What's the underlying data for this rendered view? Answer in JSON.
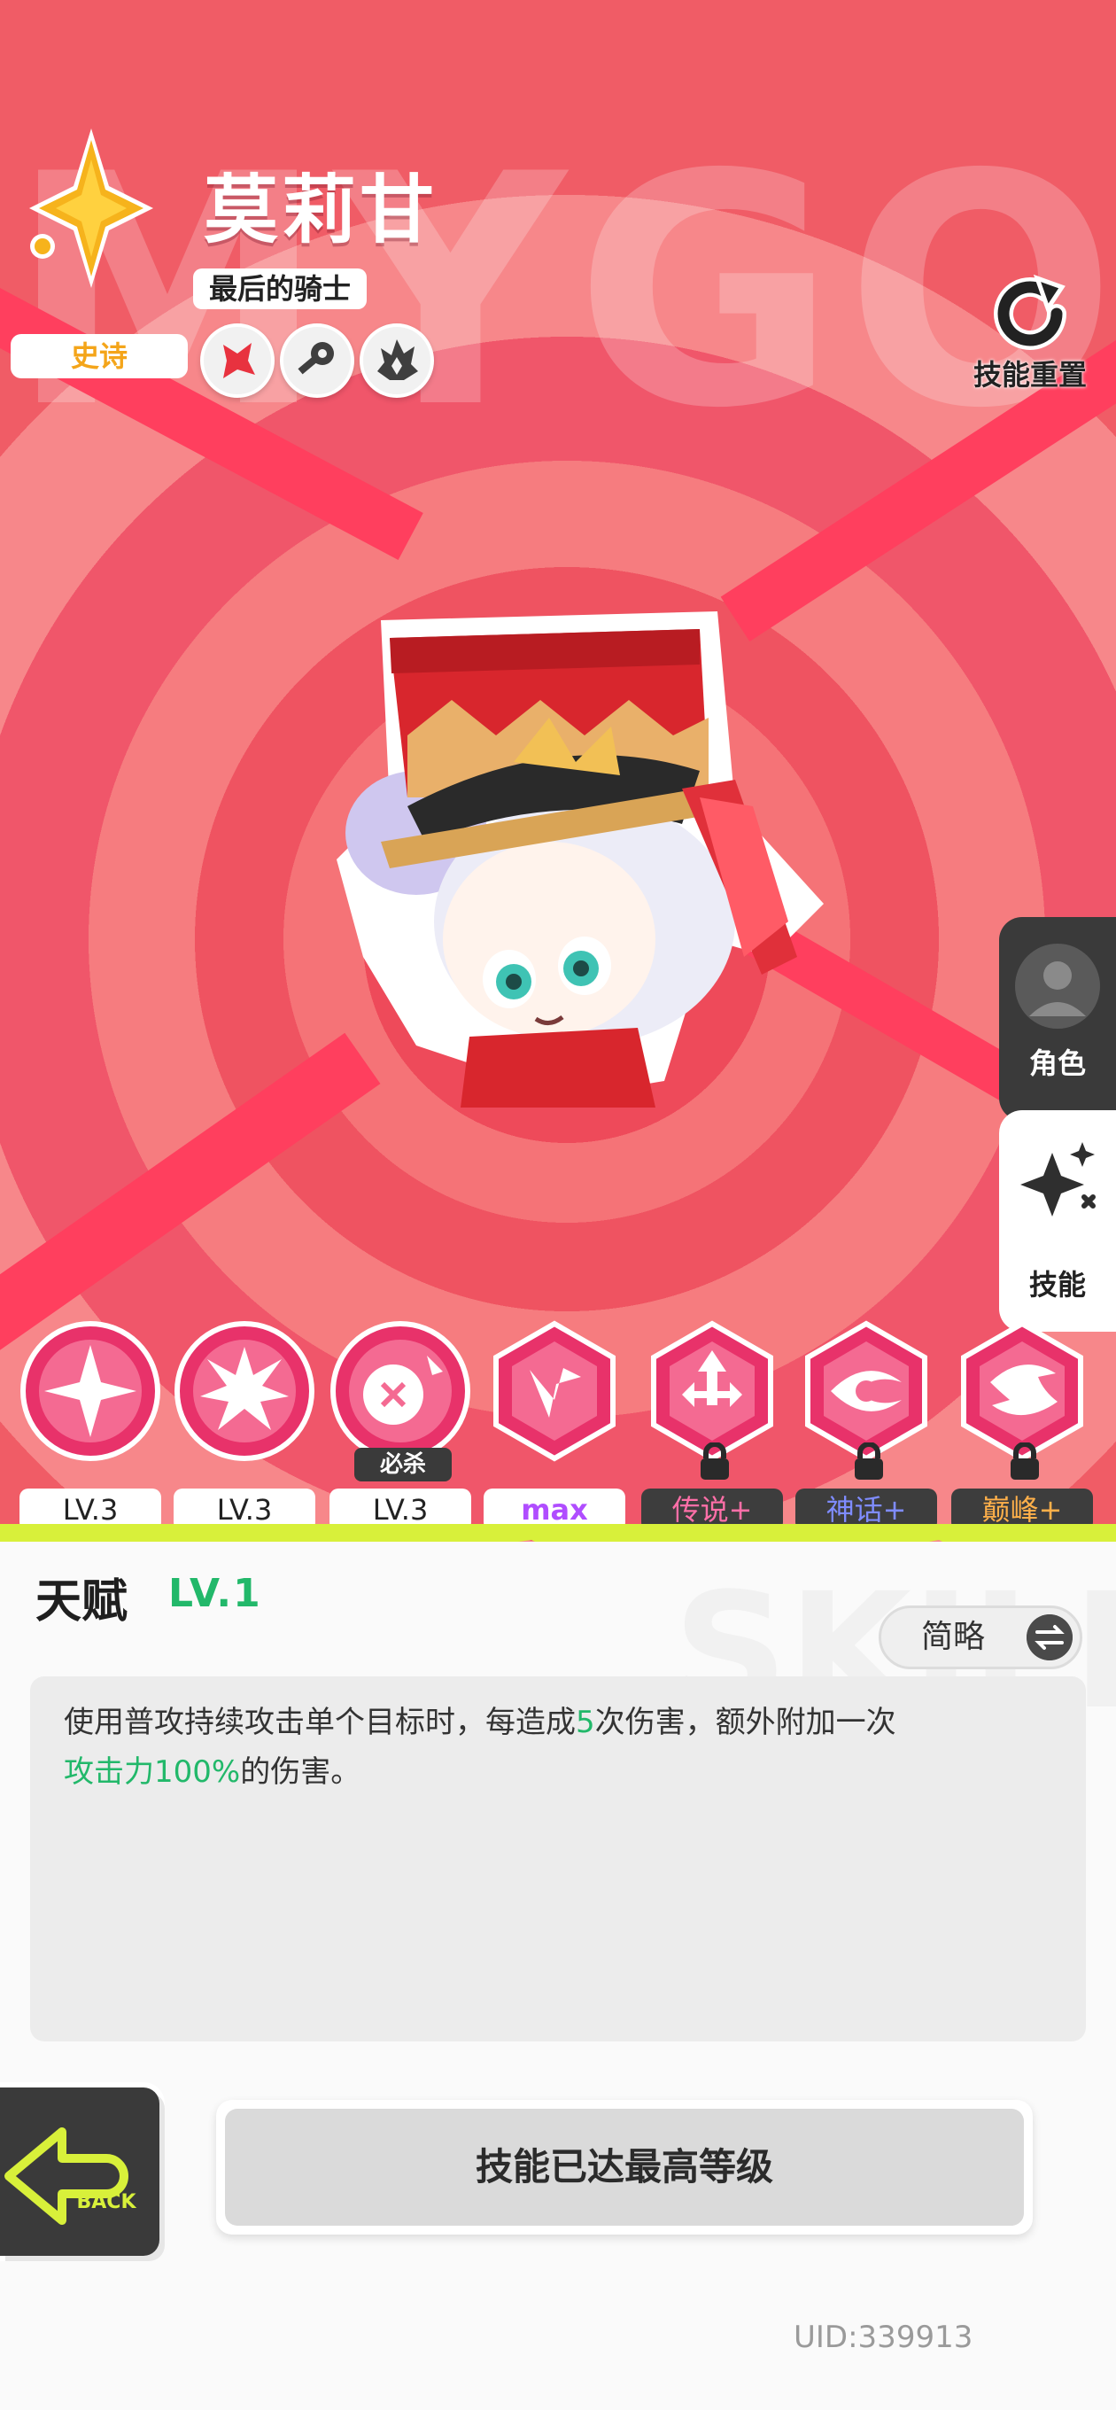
{
  "hero": {
    "name": "莫莉甘",
    "title": "最后的骑士",
    "rarity": "史诗",
    "traits": [
      "slash-trait-icon",
      "key-trait-icon",
      "flame-trait-icon"
    ]
  },
  "background_word": "MYGOD",
  "actions": {
    "reset_label": "技能重置"
  },
  "side_tabs": {
    "role_label": "角色",
    "skill_label": "技能"
  },
  "skills": [
    {
      "level": "LV.3",
      "style": "white"
    },
    {
      "level": "LV.3",
      "style": "white"
    },
    {
      "level": "LV.3",
      "style": "white",
      "tag": "必杀"
    },
    {
      "level": "max",
      "style": "white"
    },
    {
      "level": "传说+",
      "style": "dark",
      "color": "#ff6fa8",
      "locked": true
    },
    {
      "level": "神话+",
      "style": "dark",
      "color": "#7f8cff",
      "locked": true
    },
    {
      "level": "巅峰+",
      "style": "dark",
      "color": "#ffb04a",
      "locked": true
    }
  ],
  "talent": {
    "title": "天赋",
    "level": "LV.1",
    "toggle_label": "简略",
    "desc_part1": "使用普攻持续攻击单个目标时，每造成",
    "desc_num": "5",
    "desc_part2": "次伤害，额外附加一次",
    "desc_highlight": "攻击力100%",
    "desc_part3": "的伤害。"
  },
  "bottom": {
    "back_label": "BACK",
    "max_button": "技能已达最高等级",
    "uid": "UID:339913"
  },
  "colors": {
    "accent_green": "#22b86a",
    "bg_red": "#f05c66",
    "rarity_gold": "#f4a51a"
  }
}
